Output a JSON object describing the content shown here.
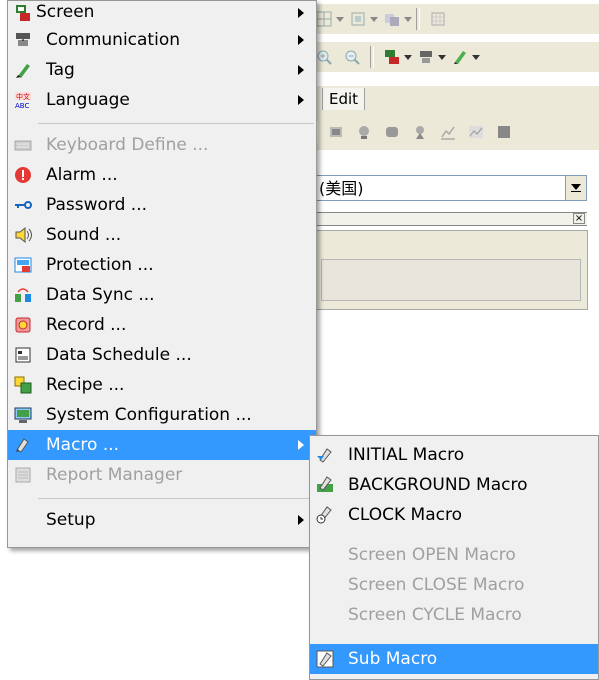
{
  "background": {
    "tab_label": "Edit",
    "combo_value": "(美国)",
    "panel_close": "×"
  },
  "menu": {
    "items": [
      {
        "label": "Screen",
        "icon": "screen-icon",
        "submenu": true
      },
      {
        "label": "Communication",
        "icon": "communication-icon",
        "submenu": true
      },
      {
        "label": "Tag",
        "icon": "tag-icon",
        "submenu": true
      },
      {
        "label": "Language",
        "icon": "language-icon",
        "submenu": true
      },
      {
        "label": "Keyboard Define ...",
        "icon": "keyboard-icon",
        "disabled": true
      },
      {
        "label": "Alarm ...",
        "icon": "alarm-icon"
      },
      {
        "label": "Password ...",
        "icon": "password-icon"
      },
      {
        "label": "Sound ...",
        "icon": "sound-icon"
      },
      {
        "label": "Protection ...",
        "icon": "protection-icon"
      },
      {
        "label": "Data Sync ...",
        "icon": "data-sync-icon"
      },
      {
        "label": "Record ...",
        "icon": "record-icon"
      },
      {
        "label": "Data Schedule ...",
        "icon": "data-schedule-icon"
      },
      {
        "label": "Recipe ...",
        "icon": "recipe-icon"
      },
      {
        "label": "System Configuration ...",
        "icon": "system-configuration-icon"
      },
      {
        "label": "Macro ...",
        "icon": "macro-icon",
        "submenu": true,
        "highlighted": true
      },
      {
        "label": "Report Manager",
        "icon": "report-manager-icon",
        "disabled": true
      },
      {
        "label": "Setup",
        "submenu": true
      }
    ]
  },
  "submenu": {
    "items": [
      {
        "label": "INITIAL Macro",
        "icon": "initial-macro-icon"
      },
      {
        "label": "BACKGROUND Macro",
        "icon": "background-macro-icon"
      },
      {
        "label": "CLOCK Macro",
        "icon": "clock-macro-icon"
      },
      {
        "label": "Screen OPEN Macro",
        "disabled": true
      },
      {
        "label": "Screen CLOSE Macro",
        "disabled": true
      },
      {
        "label": "Screen CYCLE Macro",
        "disabled": true
      },
      {
        "label": "Sub Macro",
        "icon": "sub-macro-icon",
        "highlighted": true
      }
    ]
  },
  "colors": {
    "highlight": "#3399ff",
    "menu_bg": "#f0f0f0",
    "disabled_text": "#a0a0a0"
  }
}
